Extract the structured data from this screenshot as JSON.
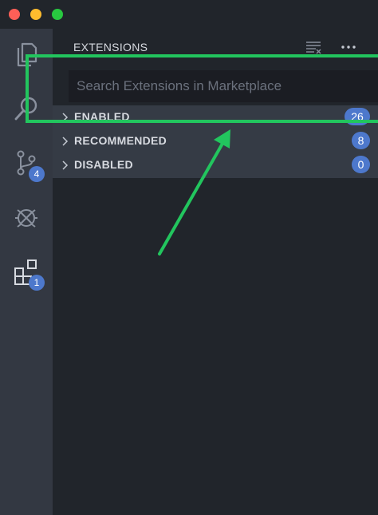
{
  "window": {
    "controls": [
      "close",
      "minimize",
      "maximize"
    ]
  },
  "activity_bar": {
    "items": [
      {
        "icon": "files-icon"
      },
      {
        "icon": "search-icon"
      },
      {
        "icon": "source-control-icon",
        "badge": "4"
      },
      {
        "icon": "debug-icon"
      },
      {
        "icon": "extensions-icon",
        "badge": "1"
      }
    ]
  },
  "sidebar": {
    "title": "EXTENSIONS",
    "actions": [
      "clear-extensions-icon",
      "more-actions-icon"
    ]
  },
  "search": {
    "placeholder": "Search Extensions in Marketplace",
    "value": ""
  },
  "sections": [
    {
      "label": "ENABLED",
      "count": "26"
    },
    {
      "label": "RECOMMENDED",
      "count": "8"
    },
    {
      "label": "DISABLED",
      "count": "0"
    }
  ],
  "annotation": {
    "color": "#22c55e"
  },
  "colors": {
    "badge": "#4d78cc",
    "activity_bar": "#333842",
    "sidebar": "#21252b",
    "section_band": "#353b45"
  }
}
